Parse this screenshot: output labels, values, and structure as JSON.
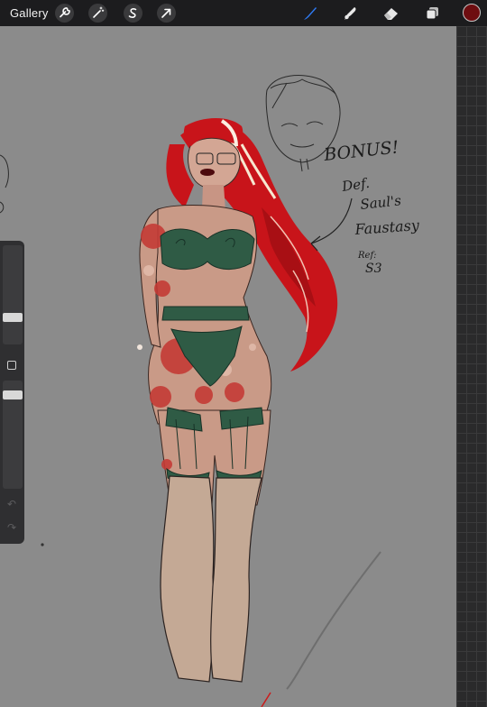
{
  "app": {
    "name": "Procreate"
  },
  "toolbar": {
    "gallery_label": "Gallery",
    "left_tools": [
      {
        "name": "actions",
        "icon": "wrench-icon"
      },
      {
        "name": "adjustments",
        "icon": "magic-wand-icon"
      },
      {
        "name": "selection",
        "icon": "selection-s-icon"
      },
      {
        "name": "transform",
        "icon": "arrow-cursor-icon"
      }
    ],
    "right_tools": [
      {
        "name": "brush",
        "icon": "brush-icon",
        "active": true,
        "color": "#2f7bf5"
      },
      {
        "name": "smudge",
        "icon": "smudge-icon",
        "active": false
      },
      {
        "name": "eraser",
        "icon": "eraser-icon",
        "active": false
      },
      {
        "name": "layers",
        "icon": "layers-icon",
        "active": false
      }
    ],
    "current_color": "#6e0d10"
  },
  "sidebar": {
    "brush_size_level": 0.3,
    "opacity_level": 0.6,
    "undo_icon": "undo-icon",
    "redo_icon": "redo-icon"
  },
  "canvas": {
    "background": "#8b8b8b",
    "annotations": {
      "bonus": "BONUS!",
      "line1": "Def.",
      "line2": "Saul's",
      "line3": "Faustasy",
      "ref": "Ref:",
      "season": "S3"
    }
  }
}
